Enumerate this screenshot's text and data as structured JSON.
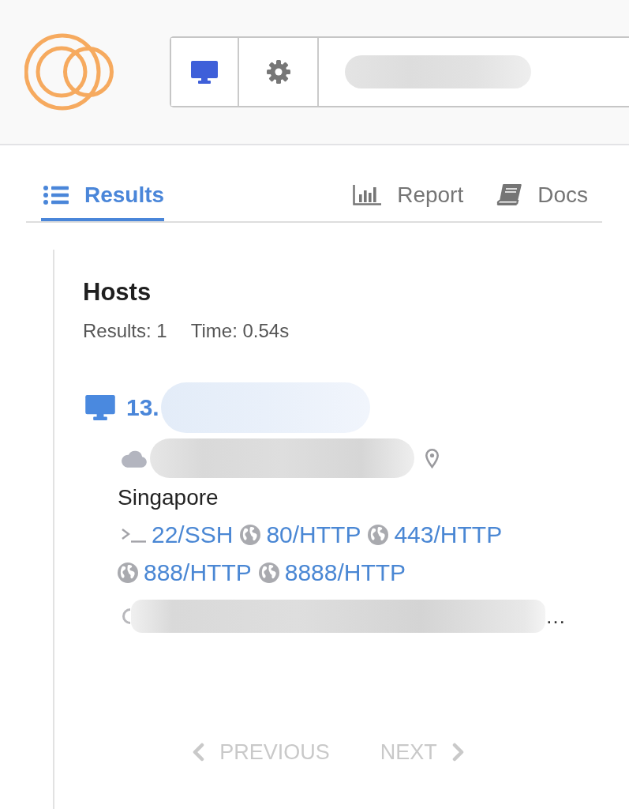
{
  "toolbar": {
    "buttons": [
      {
        "kind": "display",
        "selected": true
      },
      {
        "kind": "settings",
        "selected": false
      }
    ],
    "search": {
      "redacted": true
    }
  },
  "tabs": [
    {
      "kind": "list",
      "label": "Results",
      "selected": true
    },
    {
      "kind": "chart",
      "label": "Report",
      "selected": false
    },
    {
      "kind": "docs",
      "label": "Docs",
      "selected": false
    }
  ],
  "hosts": {
    "title": "Hosts",
    "stats": [
      "Results: 1",
      "Time: 0.54s"
    ],
    "items": [
      {
        "address": "13.",
        "address_redacted": true,
        "provider_redacted": true,
        "location": "Singapore",
        "services": [
          {
            "kind": "terminal",
            "label": "22/SSH"
          },
          {
            "kind": "web",
            "label": "80/HTTP"
          },
          {
            "kind": "web",
            "label": "443/HTTP"
          },
          {
            "kind": "web",
            "label": "888/HTTP"
          },
          {
            "kind": "web",
            "label": "8888/HTTP"
          }
        ],
        "detail": {
          "text": "…",
          "redacted": true
        }
      }
    ]
  },
  "pagination": {
    "previous": {
      "label": "PREVIOUS",
      "disabled": true
    },
    "next": {
      "label": "NEXT",
      "disabled": true
    }
  }
}
